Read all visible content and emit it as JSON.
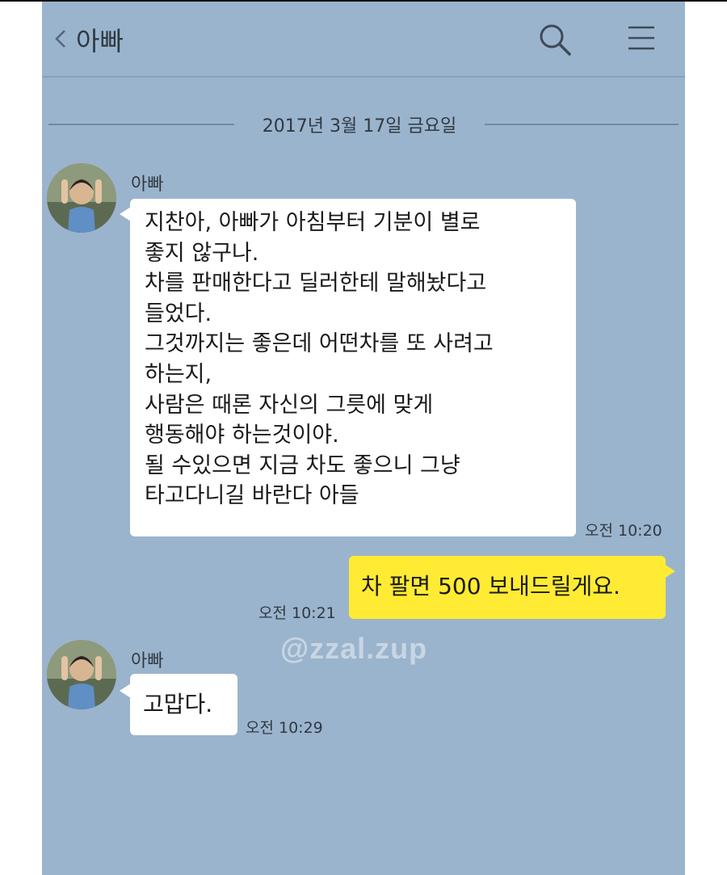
{
  "header": {
    "title": "아빠"
  },
  "date_divider": "2017년 3월 17일 금요일",
  "messages": [
    {
      "sender": "아빠",
      "lines": [
        "지찬아, 아빠가 아침부터 기분이 별로",
        "좋지 않구나.",
        "차를 판매한다고 딜러한테 말해놨다고",
        "들었다.",
        "그것까지는 좋은데 어떤차를 또 사려고",
        "하는지,",
        "사람은 때론 자신의 그릇에 맞게",
        "행동해야 하는것이야.",
        "될 수있으면 지금 차도 좋으니 그냥",
        "타고다니길 바란다 아들"
      ],
      "time": "오전 10:20"
    },
    {
      "sender": "me",
      "text": "차 팔면 500 보내드릴게요.",
      "time": "오전 10:21"
    },
    {
      "sender": "아빠",
      "text": "고맙다.",
      "time": "오전 10:29"
    }
  ],
  "watermark": "@zzal.zup",
  "colors": {
    "chat_background": "#9bb4cd",
    "my_bubble": "#ffeb33",
    "other_bubble": "#ffffff"
  }
}
